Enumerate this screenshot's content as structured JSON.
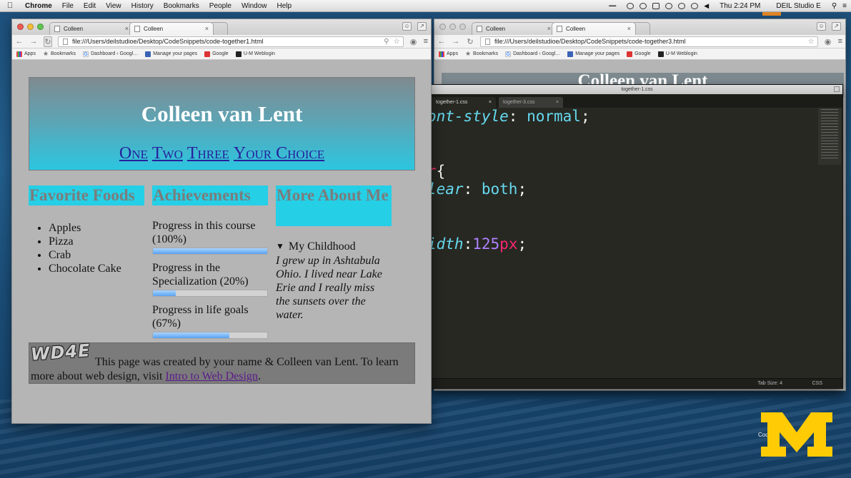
{
  "menubar": {
    "app": "Chrome",
    "items": [
      "File",
      "Edit",
      "View",
      "History",
      "Bookmarks",
      "People",
      "Window",
      "Help"
    ],
    "clock": "Thu 2:24 PM",
    "user": "DEIL Studio E"
  },
  "bookmarks": [
    {
      "label": "Apps",
      "icon": "apps-grid-icon"
    },
    {
      "label": "Bookmarks",
      "icon": "star-icon"
    },
    {
      "label": "Dashboard ‹ Googl…",
      "icon": "google-icon"
    },
    {
      "label": "Manage your pages",
      "icon": "pages-icon"
    },
    {
      "label": "Google",
      "icon": "google-red-icon"
    },
    {
      "label": "U-M Weblogin",
      "icon": "umich-icon"
    }
  ],
  "left_window": {
    "tabs": [
      "Colleen",
      "Colleen"
    ],
    "url": "file:///Users/deilstudioe/Desktop/CodeSnippets/code-together1.html",
    "page": {
      "title": "Colleen van Lent",
      "nav": [
        "One",
        "Two",
        "Three",
        "Your Choice"
      ],
      "foods_heading": "Favorite Foods",
      "foods": [
        "Apples",
        "Pizza",
        "Crab",
        "Chocolate Cake"
      ],
      "achievements_heading": "Achievements",
      "progress": [
        {
          "label": "Progress in this course (100%)",
          "value": 1.0
        },
        {
          "label": "Progress in the Specialization (20%)",
          "value": 0.2
        },
        {
          "label": "Progress in life goals (67%)",
          "value": 0.67
        }
      ],
      "about_heading": "More About Me",
      "details_summary": "My Childhood",
      "details_text": "I grew up in Ashtabula Ohio. I lived near Lake Erie and I really miss the sunsets over the water.",
      "footer_logo": "WD4E",
      "footer_text": "This page was created by your name & Colleen van Lent. To learn more about web design, visit ",
      "footer_link": "Intro to Web Design",
      "footer_end": "."
    }
  },
  "right_window": {
    "tabs": [
      "Colleen",
      "Colleen"
    ],
    "url": "file:///Users/deilstudioe/Desktop/CodeSnippets/code-together3.html",
    "header_text": "Colleen van Lent"
  },
  "editor": {
    "title": "together-1.css",
    "tabs": [
      "together-1.css",
      "together-3.css"
    ],
    "code_lines": [
      [
        {
          "t": "ont-style",
          "c": "tk-prop"
        },
        {
          "t": ": ",
          "c": ""
        },
        {
          "t": "normal",
          "c": "tk-val"
        },
        {
          "t": ";",
          "c": ""
        }
      ],
      [],
      [],
      [
        {
          "t": "r",
          "c": "tk-sel"
        },
        {
          "t": "{",
          "c": ""
        }
      ],
      [
        {
          "t": "lear",
          "c": "tk-prop"
        },
        {
          "t": ": ",
          "c": ""
        },
        {
          "t": "both",
          "c": "tk-val"
        },
        {
          "t": ";",
          "c": ""
        }
      ],
      [],
      [],
      [
        {
          "t": "idth",
          "c": "tk-prop"
        },
        {
          "t": ":",
          "c": ""
        },
        {
          "t": "125",
          "c": "tk-num"
        },
        {
          "t": "px",
          "c": "tk-unit"
        },
        {
          "t": ";",
          "c": ""
        }
      ]
    ],
    "tab_size": "Tab Size: 4",
    "syntax": "CSS"
  },
  "brand": {
    "label": "Code",
    "color": "#ffcb05"
  }
}
